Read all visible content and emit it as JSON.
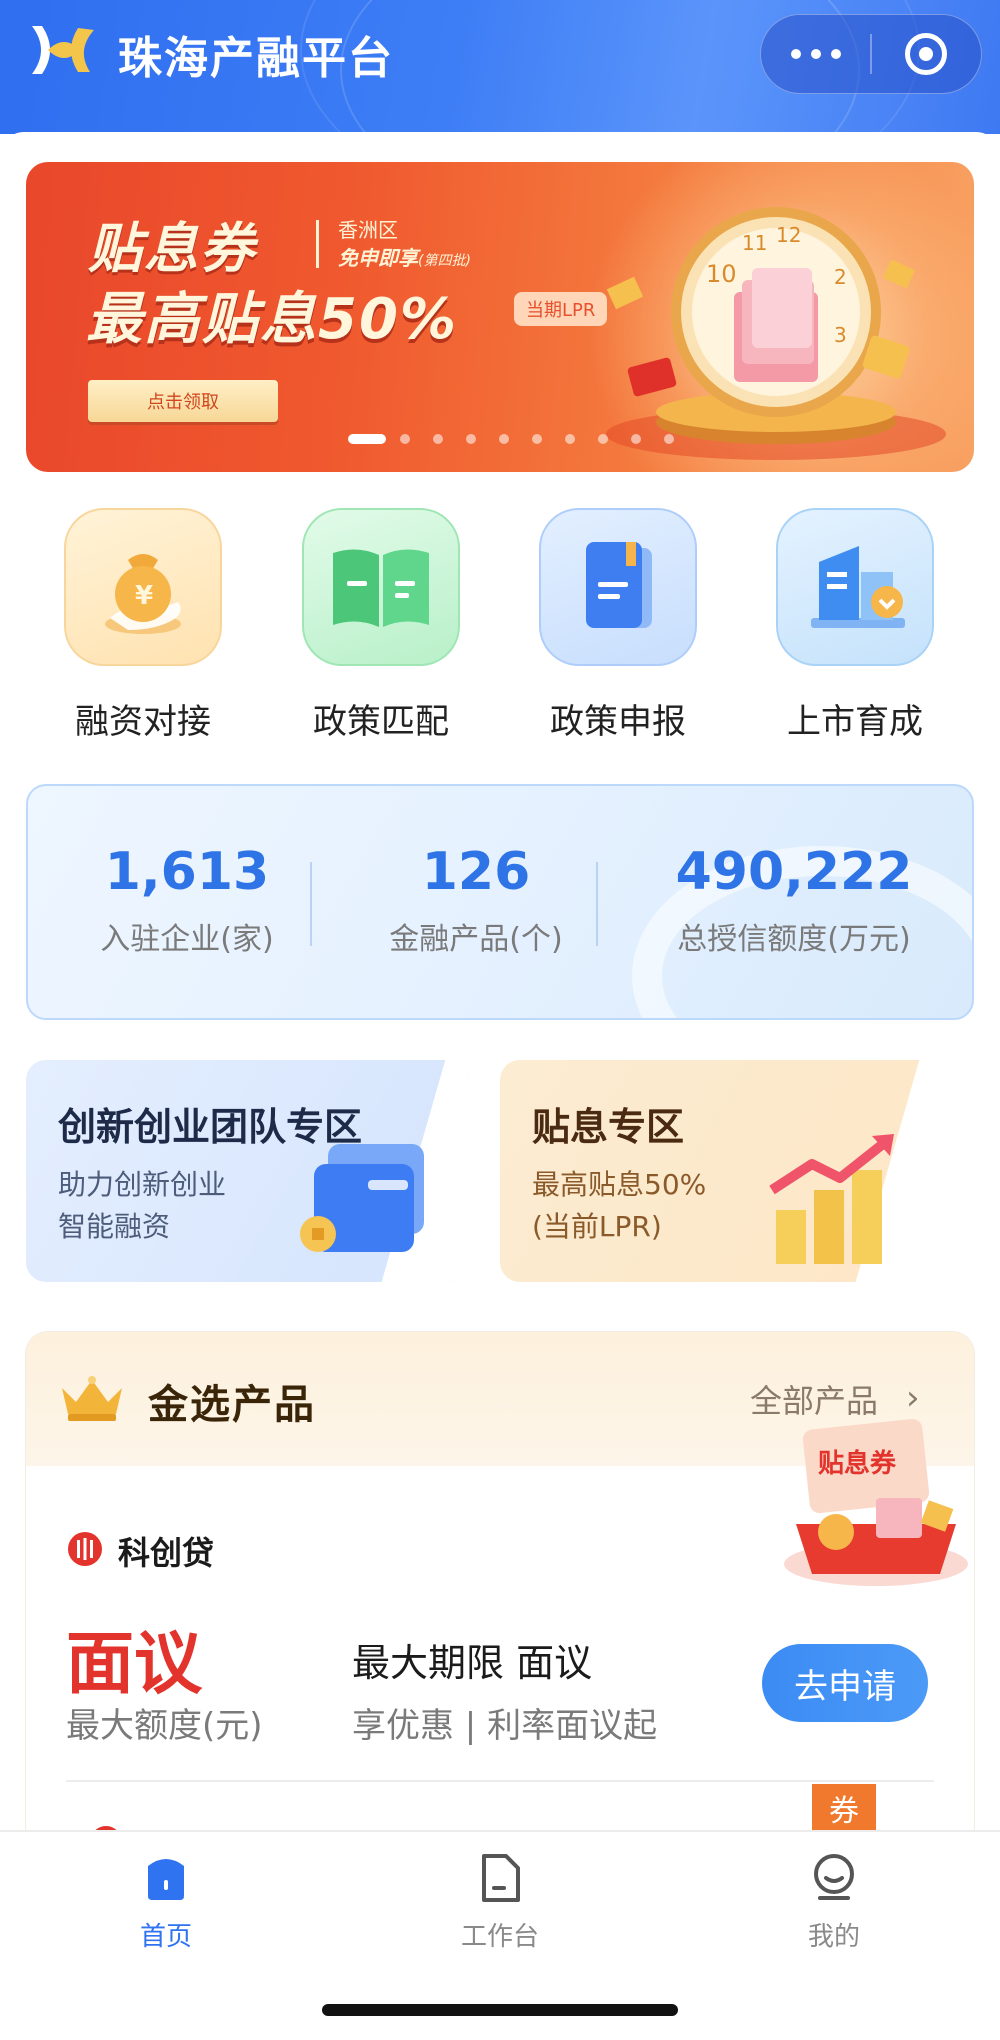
{
  "header": {
    "title": "珠海产融平台",
    "more_icon": "more-dots-icon",
    "target_icon": "target-icon"
  },
  "banner": {
    "title": "贴息券",
    "district": "香洲区",
    "free_apply": "免申即享",
    "batch": "(第四批)",
    "headline": "最高贴息50%",
    "lpr_tag": "当期LPR",
    "cta": "点击领取",
    "page_count": 10,
    "active_index": 0
  },
  "quick_actions": [
    {
      "label": "融资对接",
      "icon": "money-bag-icon"
    },
    {
      "label": "政策匹配",
      "icon": "open-book-icon"
    },
    {
      "label": "政策申报",
      "icon": "document-book-icon"
    },
    {
      "label": "上市育成",
      "icon": "building-icon"
    }
  ],
  "stats": [
    {
      "value": "1,613",
      "caption": "入驻企业(家)"
    },
    {
      "value": "126",
      "caption": "金融产品(个)"
    },
    {
      "value": "490,222",
      "caption": "总授信额度(万元)"
    }
  ],
  "zones": {
    "innovation": {
      "title": "创新创业团队专区",
      "line1": "助力创新创业",
      "line2": "智能融资"
    },
    "subsidy": {
      "title": "贴息专区",
      "line1": "最高贴息50%",
      "line2": "(当前LPR)"
    }
  },
  "products": {
    "title": "金选产品",
    "all_link": "全部产品",
    "chevron": "›",
    "coupon_art_text": "贴息券",
    "items": [
      {
        "name": "科创贷",
        "amount": "面议",
        "amount_caption": "最大额度(元)",
        "term": "最大期限 面议",
        "benefit": "享优惠 | 利率面议起",
        "apply": "去申请"
      }
    ],
    "next_tag": "券"
  },
  "tabbar": [
    {
      "label": "首页",
      "icon": "home-icon",
      "active": true
    },
    {
      "label": "工作台",
      "icon": "document-icon",
      "active": false
    },
    {
      "label": "我的",
      "icon": "profile-icon",
      "active": false
    }
  ],
  "colors": {
    "primary": "#2f73f0",
    "banner_red": "#e9472b",
    "price_red": "#e2332c",
    "tag_orange": "#f0792d"
  }
}
